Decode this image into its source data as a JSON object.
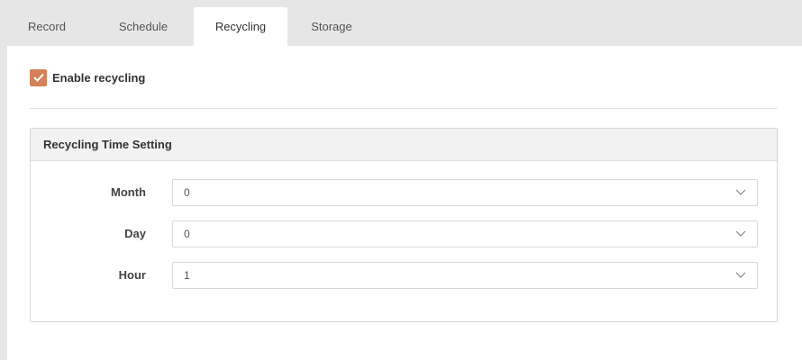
{
  "tabs": [
    {
      "label": "Record",
      "active": false
    },
    {
      "label": "Schedule",
      "active": false
    },
    {
      "label": "Recycling",
      "active": true
    },
    {
      "label": "Storage",
      "active": false
    }
  ],
  "enable_recycling": {
    "label": "Enable recycling",
    "checked": true
  },
  "recycling_time": {
    "title": "Recycling Time Setting",
    "fields": [
      {
        "label": "Month",
        "value": "0"
      },
      {
        "label": "Day",
        "value": "0"
      },
      {
        "label": "Hour",
        "value": "1"
      }
    ]
  },
  "colors": {
    "accent": "#d4825a",
    "tabbar_bg": "#e6e6e6",
    "panel_bg": "#ffffff"
  },
  "icons": {
    "checkbox": "check-icon",
    "select": "chevron-down-icon"
  }
}
